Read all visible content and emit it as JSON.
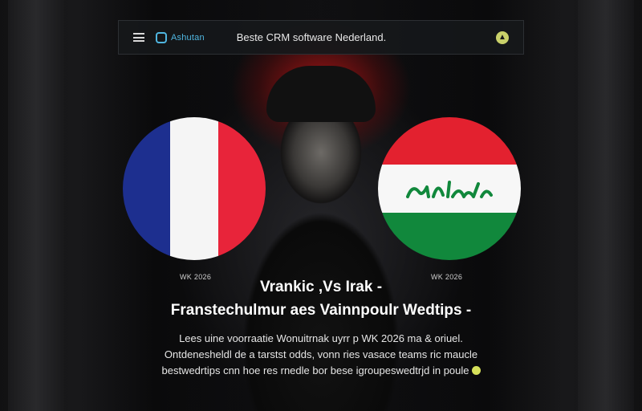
{
  "header": {
    "logo_text": "Ashutan",
    "title": "Beste CRM software Nederland.",
    "account_icon": "user-icon"
  },
  "match": {
    "left_label": "WK 2026",
    "right_label": "WK 2026",
    "left_team_flag": "france-flag",
    "right_team_flag": "iraq-flag",
    "title_line_1": "Vrankic ,Vs Irak -",
    "title_line_2": "Franstechulmur aes Vainnpoulr Wedtips -",
    "description_lines": [
      "Lees uine voorraatie Wonuitrnak uyrr p WK 2026 ma & oriuel.",
      "Ontdenesheldl de a tarstst odds, vonn ries vasace teams ric maucle",
      "bestwedrtips cnn hoe res rnedle bor bese igroupeswedtrjd in poule"
    ]
  },
  "colors": {
    "accent_red": "#c41414",
    "logo_blue": "#4fb6e0",
    "more_dot": "#d6e05a"
  }
}
